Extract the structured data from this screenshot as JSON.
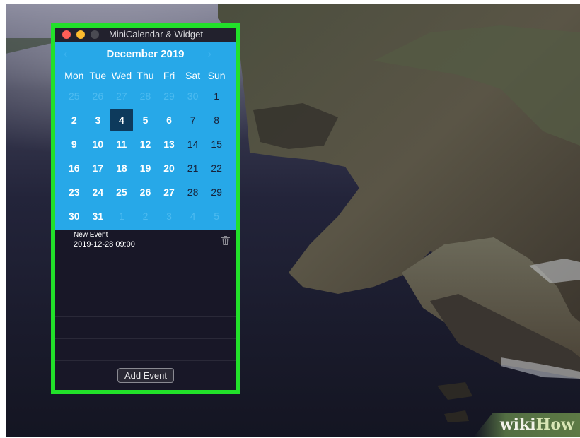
{
  "window": {
    "title": "MiniCalendar & Widget"
  },
  "calendar": {
    "month_label": "December 2019",
    "prev_symbol": "‹",
    "next_symbol": "›",
    "weekdays": [
      "Mon",
      "Tue",
      "Wed",
      "Thu",
      "Fri",
      "Sat",
      "Sun"
    ],
    "days": [
      {
        "d": "25",
        "kind": "other"
      },
      {
        "d": "26",
        "kind": "other"
      },
      {
        "d": "27",
        "kind": "other"
      },
      {
        "d": "28",
        "kind": "other"
      },
      {
        "d": "29",
        "kind": "other"
      },
      {
        "d": "30",
        "kind": "other"
      },
      {
        "d": "1",
        "kind": "weekend"
      },
      {
        "d": "2",
        "kind": "normal"
      },
      {
        "d": "3",
        "kind": "normal"
      },
      {
        "d": "4",
        "kind": "today"
      },
      {
        "d": "5",
        "kind": "normal"
      },
      {
        "d": "6",
        "kind": "normal"
      },
      {
        "d": "7",
        "kind": "weekend"
      },
      {
        "d": "8",
        "kind": "weekend"
      },
      {
        "d": "9",
        "kind": "normal"
      },
      {
        "d": "10",
        "kind": "normal"
      },
      {
        "d": "11",
        "kind": "normal"
      },
      {
        "d": "12",
        "kind": "normal"
      },
      {
        "d": "13",
        "kind": "normal"
      },
      {
        "d": "14",
        "kind": "weekend"
      },
      {
        "d": "15",
        "kind": "weekend"
      },
      {
        "d": "16",
        "kind": "normal"
      },
      {
        "d": "17",
        "kind": "normal"
      },
      {
        "d": "18",
        "kind": "normal"
      },
      {
        "d": "19",
        "kind": "normal"
      },
      {
        "d": "20",
        "kind": "normal"
      },
      {
        "d": "21",
        "kind": "weekend"
      },
      {
        "d": "22",
        "kind": "weekend"
      },
      {
        "d": "23",
        "kind": "normal"
      },
      {
        "d": "24",
        "kind": "normal"
      },
      {
        "d": "25",
        "kind": "normal"
      },
      {
        "d": "26",
        "kind": "normal"
      },
      {
        "d": "27",
        "kind": "normal"
      },
      {
        "d": "28",
        "kind": "weekend"
      },
      {
        "d": "29",
        "kind": "weekend"
      },
      {
        "d": "30",
        "kind": "normal"
      },
      {
        "d": "31",
        "kind": "normal"
      },
      {
        "d": "1",
        "kind": "other"
      },
      {
        "d": "2",
        "kind": "other"
      },
      {
        "d": "3",
        "kind": "other"
      },
      {
        "d": "4",
        "kind": "other"
      },
      {
        "d": "5",
        "kind": "other"
      }
    ]
  },
  "events": {
    "items": [
      {
        "name": "New Event",
        "datetime": "2019-12-28 09:00"
      }
    ],
    "add_button_label": "Add Event"
  },
  "watermark": {
    "part1": "wiki",
    "part2": "How"
  },
  "colors": {
    "highlight": "#22e02a",
    "calendar_bg": "#27a8e8",
    "today_bg": "#0d3a5c"
  }
}
